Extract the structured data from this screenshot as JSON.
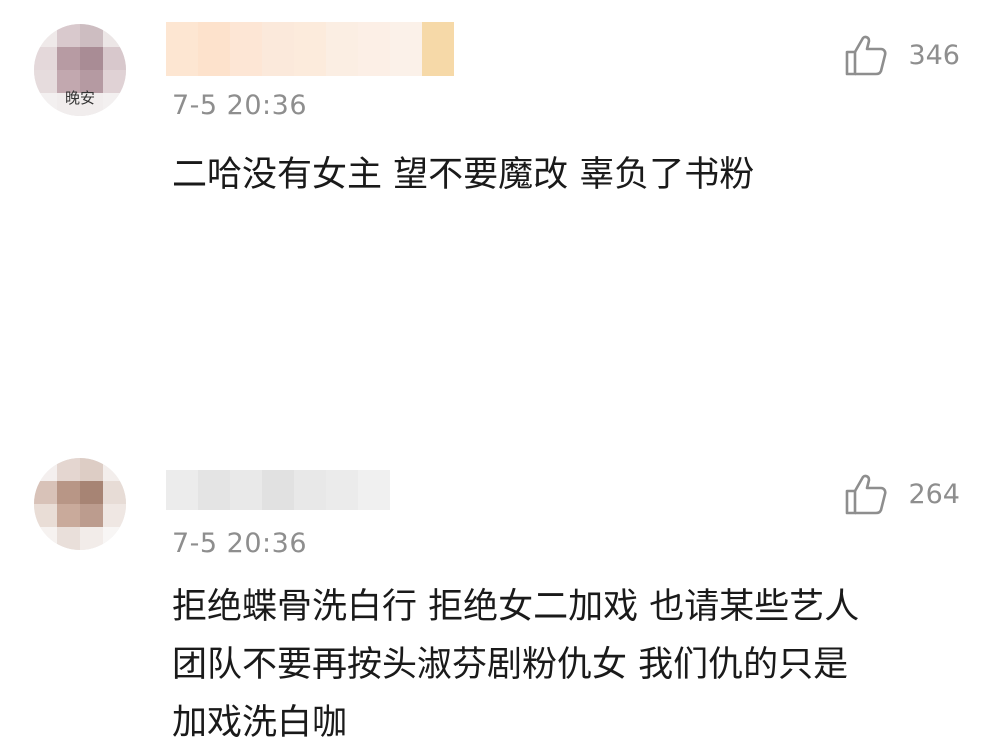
{
  "comments": [
    {
      "avatar_caption": "晚安",
      "timestamp": "7-5 20:36",
      "like_count": "346",
      "text_lines": [
        "二哈没有女主 望不要魔改 辜负了书粉"
      ]
    },
    {
      "avatar_caption": "",
      "timestamp": "7-5 20:36",
      "like_count": "264",
      "text_lines": [
        "拒绝蝶骨洗白行 拒绝女二加戏 也请某些艺人",
        "团队不要再按头淑芬剧粉仇女 我们仇的只是",
        "加戏洗白咖"
      ]
    }
  ],
  "icons": {
    "like": "thumbs-up-icon"
  },
  "colors": {
    "meta_text": "#8e8e8e",
    "body_text": "#1a1a1a",
    "icon_stroke": "#8e8e8e"
  }
}
